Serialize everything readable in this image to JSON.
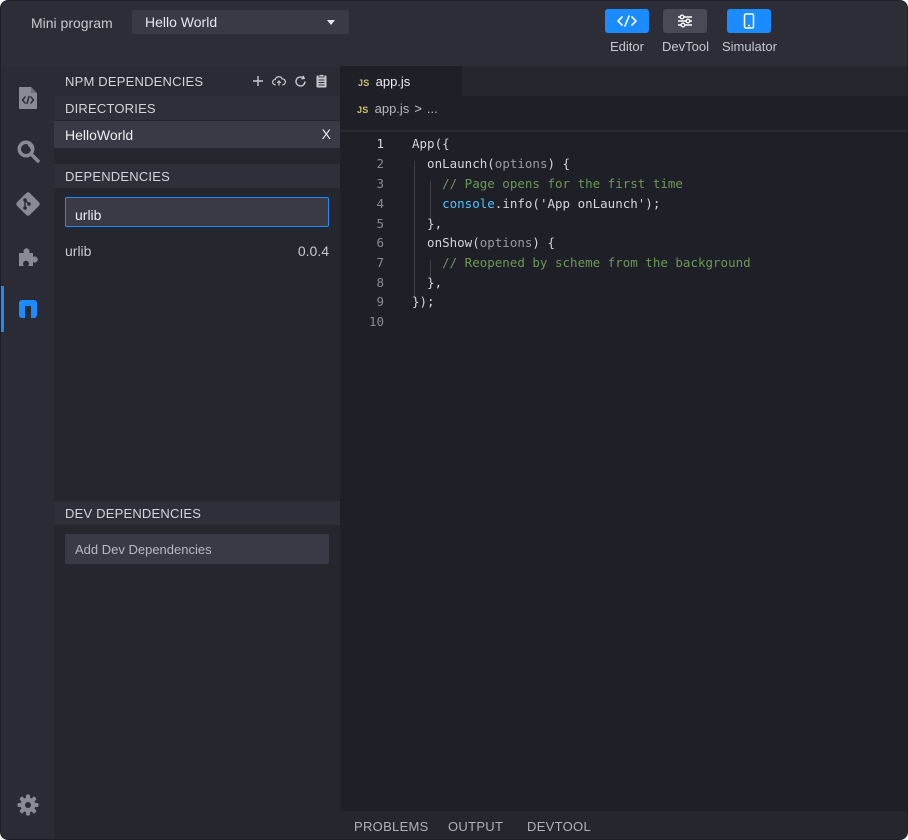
{
  "topbar": {
    "mini_program_label": "Mini program",
    "project_selected": "Hello World",
    "modes": [
      {
        "label": "Editor",
        "active": true
      },
      {
        "label": "DevTool",
        "active": false
      },
      {
        "label": "Simulator",
        "active": true
      }
    ]
  },
  "activity_bar": {
    "items": [
      "code-file-icon",
      "search-icon",
      "git-icon",
      "extensions-icon",
      "npm-icon"
    ],
    "active_index": 4,
    "bottom": "settings-gear-icon"
  },
  "sidebar": {
    "title": "NPM DEPENDENCIES",
    "actions": [
      "add-icon",
      "cloud-upload-icon",
      "refresh-icon",
      "clipboard-icon"
    ],
    "directories": {
      "header": "DIRECTORIES",
      "items": [
        {
          "name": "HelloWorld",
          "close": "X"
        }
      ]
    },
    "dependencies": {
      "header": "DEPENDENCIES",
      "search_value": "urlib",
      "items": [
        {
          "name": "urlib",
          "version": "0.0.4"
        }
      ]
    },
    "dev_dependencies": {
      "header": "DEV DEPENDENCIES",
      "add_placeholder": "Add Dev Dependencies"
    }
  },
  "editor": {
    "tab": {
      "badge": "JS",
      "label": "app.js"
    },
    "breadcrumb": {
      "badge": "JS",
      "file": "app.js",
      "separator": ">",
      "more": "..."
    },
    "lines": [
      {
        "num": "1"
      },
      {
        "num": "2"
      },
      {
        "num": "3"
      },
      {
        "num": "4"
      },
      {
        "num": "5"
      },
      {
        "num": "6"
      },
      {
        "num": "7"
      },
      {
        "num": "8"
      },
      {
        "num": "9"
      },
      {
        "num": "10"
      }
    ],
    "code": {
      "l1": "App({",
      "l2a": "  onLaunch(",
      "l2b": "options",
      "l2c": ") {",
      "l3": "    // Page opens for the first time",
      "l4a": "    ",
      "l4b": "console",
      "l4c": ".info('App onLaunch');",
      "l5": "  },",
      "l6a": "  onShow(",
      "l6b": "options",
      "l6c": ") {",
      "l7": "    // Reopened by scheme from the background",
      "l8": "  },",
      "l9": "});",
      "l10": ""
    }
  },
  "panel": {
    "tabs": [
      "PROBLEMS",
      "OUTPUT",
      "DEVTOOL"
    ]
  },
  "colors": {
    "accent": "#1a8cff",
    "comment": "#6a9955",
    "js_badge": "#c9c36a"
  }
}
